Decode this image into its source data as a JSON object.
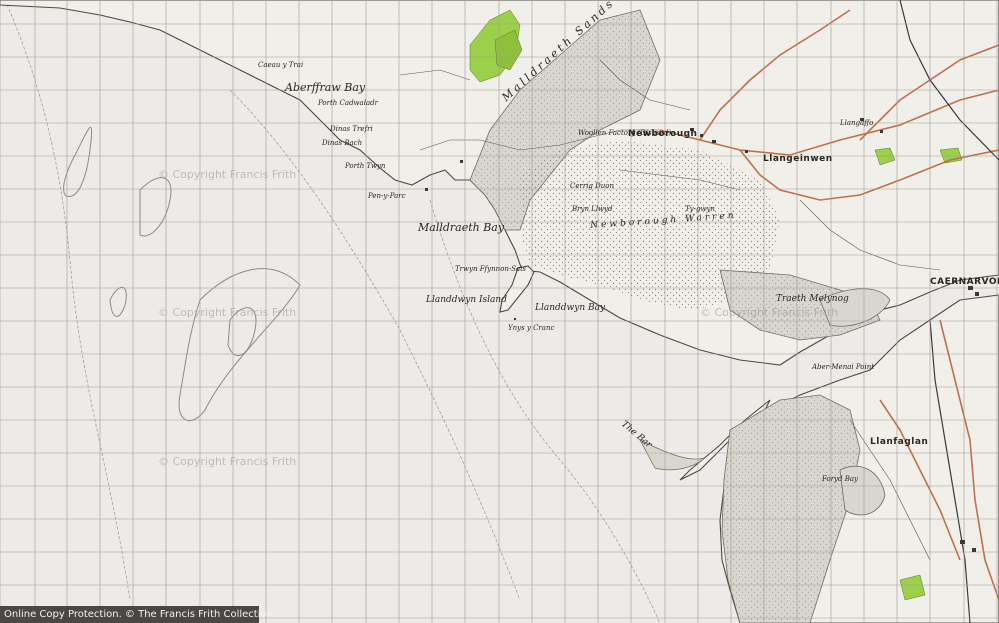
{
  "watermark": "© Copyright Francis Frith",
  "footer": "Online Copy Protection. © The Francis Frith Collection",
  "colors": {
    "sea": "#ecebe8",
    "land": "#f1efe9",
    "sand": "#d9d6cf",
    "woodland": "#9ccf4a",
    "grid": "#9d9b97",
    "roads": "#c0704a",
    "railway": "#3a3a3a"
  },
  "labels": {
    "aberffraw_bay": "Aberffraw Bay",
    "porth_cadwaladr": "Porth Cadwaladr",
    "dinas_trefri": "Dinas Trefri",
    "dinas_bach": "Dinas Bach",
    "porth_twyn": "Porth Twyn",
    "pen_y_parc": "Pen-y-Parc",
    "malldraeth_bay": "Malldraeth Bay",
    "malldraeth_sands": "Malldraeth Sands",
    "cerrig_duon": "Cerrig Duon",
    "newborough_warren": "Newborough Warren",
    "newborough": "Newborough",
    "llangeinwen": "Llangeinwen",
    "caernarvon": "CAERNARVON",
    "llanddwyn_island": "Llanddwyn Island",
    "llanddwyn_bay": "Llanddwyn Bay",
    "trwyn_ffynnon_sais": "Trwyn Ffynnon-Sais",
    "ynys_y_cranc": "Ynys y Cranc",
    "tr_arth_melynog": "Traeth Melynog",
    "the_bar": "The Bar",
    "abermenai_point": "Aber-Menai Point",
    "llanfaglan": "Llanfaglan",
    "foryd_bay": "Foryd Bay",
    "woollen_factory": "Woollen Factory (Disused)",
    "bryn_llwyd": "Bryn Llwyd",
    "llangaffo": "Llangaffo",
    "ty_gwyn": "Ty-gwyn",
    "aberffraw_cem": "Caeau y Trai"
  }
}
